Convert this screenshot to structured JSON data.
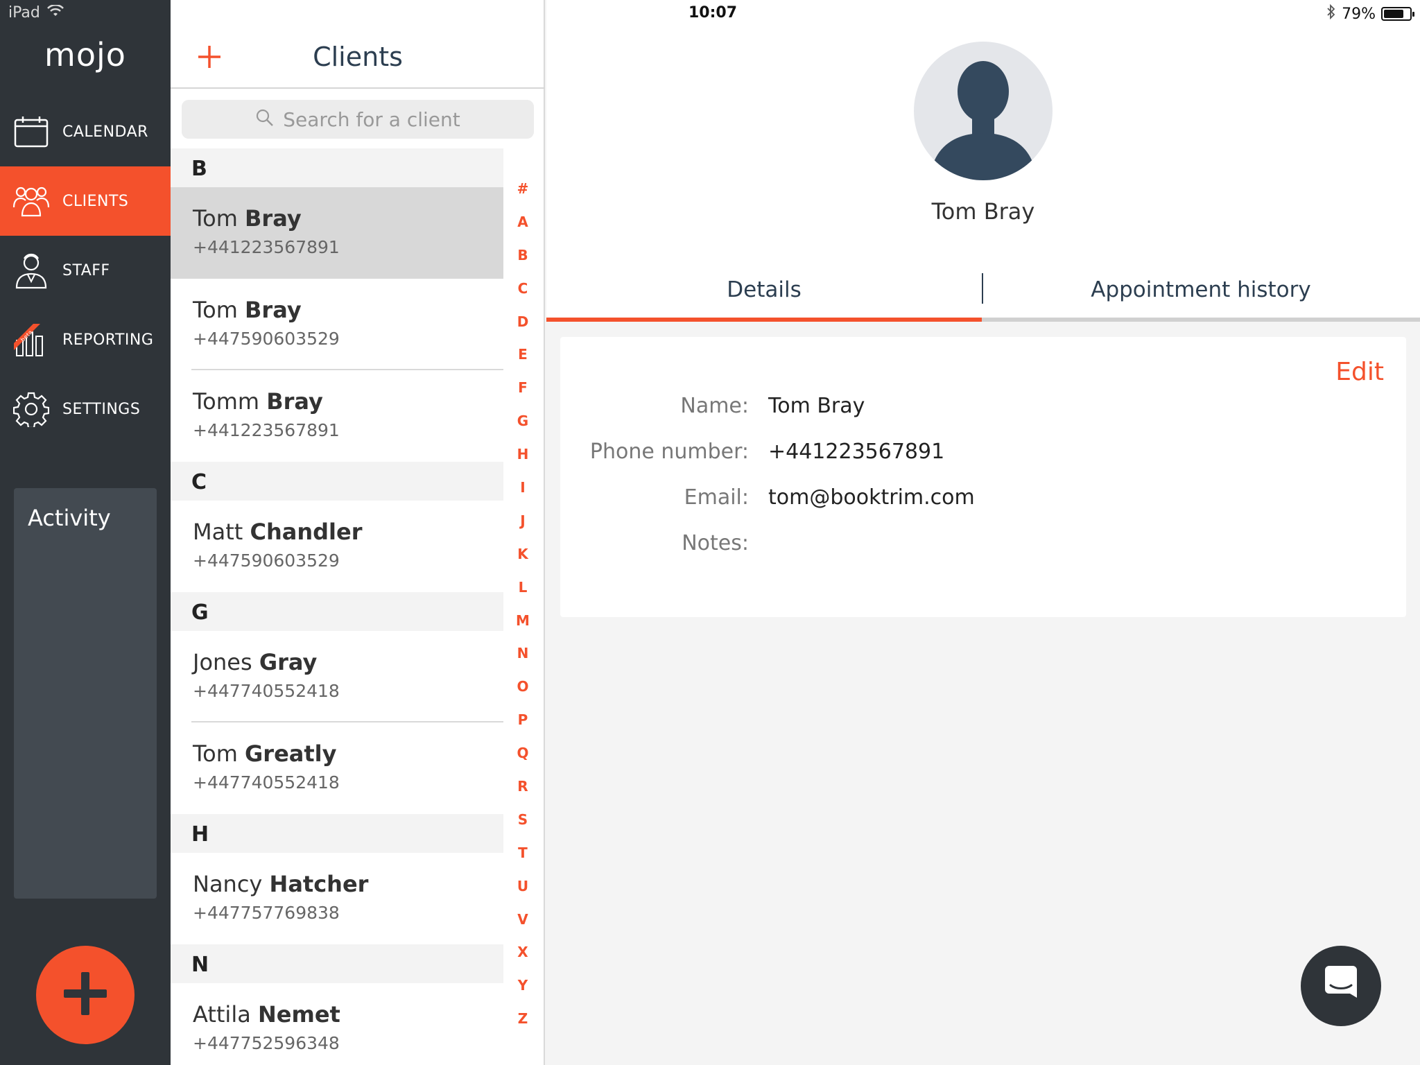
{
  "status_bar": {
    "device": "iPad",
    "time": "10:07",
    "battery": "79%",
    "battery_level": 0.79
  },
  "sidebar": {
    "logo": "mojo",
    "items": [
      {
        "label": "CALENDAR",
        "icon": "calendar-icon",
        "active": false
      },
      {
        "label": "CLIENTS",
        "icon": "clients-icon",
        "active": true
      },
      {
        "label": "STAFF",
        "icon": "staff-icon",
        "active": false
      },
      {
        "label": "REPORTING",
        "icon": "reporting-icon",
        "badge": "beta",
        "active": false
      },
      {
        "label": "SETTINGS",
        "icon": "gear-icon",
        "active": false
      }
    ],
    "activity_title": "Activity"
  },
  "client_list": {
    "title": "Clients",
    "search_placeholder": "Search for a client",
    "sections": [
      {
        "letter": "B",
        "clients": [
          {
            "first": "Tom",
            "last": "Bray",
            "phone": "+441223567891",
            "selected": true
          },
          {
            "first": "Tom",
            "last": "Bray",
            "phone": "+447590603529"
          },
          {
            "first": "Tomm",
            "last": "Bray",
            "phone": "+441223567891"
          }
        ]
      },
      {
        "letter": "C",
        "clients": [
          {
            "first": "Matt",
            "last": "Chandler",
            "phone": "+447590603529"
          }
        ]
      },
      {
        "letter": "G",
        "clients": [
          {
            "first": "Jones",
            "last": "Gray",
            "phone": "+447740552418"
          },
          {
            "first": "Tom",
            "last": "Greatly",
            "phone": "+447740552418"
          }
        ]
      },
      {
        "letter": "H",
        "clients": [
          {
            "first": "Nancy",
            "last": "Hatcher",
            "phone": "+447757769838"
          }
        ]
      },
      {
        "letter": "N",
        "clients": [
          {
            "first": "Attila",
            "last": "Nemet",
            "phone": "+447752596348"
          }
        ]
      }
    ],
    "alpha_index": [
      "#",
      "A",
      "B",
      "C",
      "D",
      "E",
      "F",
      "G",
      "H",
      "I",
      "J",
      "K",
      "L",
      "M",
      "N",
      "O",
      "P",
      "Q",
      "R",
      "S",
      "T",
      "U",
      "V",
      "X",
      "Y",
      "Z"
    ]
  },
  "detail": {
    "name": "Tom Bray",
    "tabs": {
      "details": "Details",
      "history": "Appointment history"
    },
    "edit_label": "Edit",
    "fields": [
      {
        "label": "Name:",
        "value": "Tom Bray"
      },
      {
        "label": "Phone number:",
        "value": "+441223567891"
      },
      {
        "label": "Email:",
        "value": "tom@booktrim.com"
      },
      {
        "label": "Notes:",
        "value": ""
      }
    ]
  },
  "colors": {
    "accent": "#f4512c",
    "sidebar_bg": "#2f3439",
    "activity_bg": "#434a51",
    "title_text": "#2c3e50"
  }
}
